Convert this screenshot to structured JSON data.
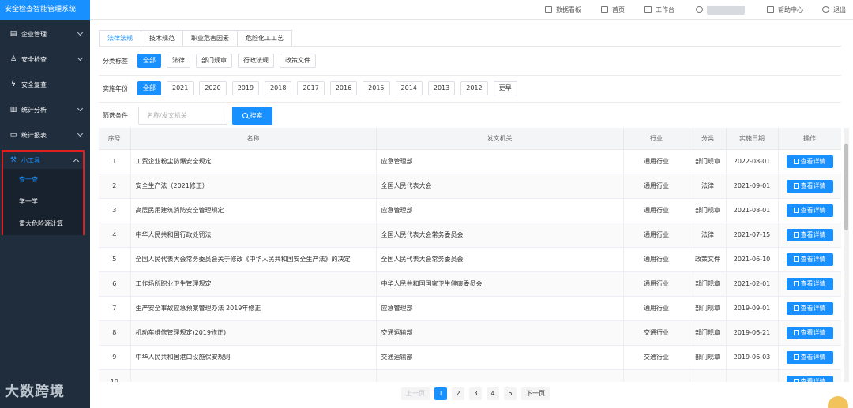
{
  "app": {
    "title": "安全检查智能管理系统"
  },
  "sidebar": {
    "items": [
      {
        "label": "企业管理",
        "icon": "building-icon"
      },
      {
        "label": "安全检查",
        "icon": "user-check-icon"
      },
      {
        "label": "安全复查",
        "icon": "lightning-icon"
      },
      {
        "label": "统计分析",
        "icon": "clipboard-icon"
      },
      {
        "label": "统计报表",
        "icon": "folder-icon"
      }
    ],
    "tools": {
      "label": "小工具",
      "icon": "tools-icon",
      "children": [
        {
          "label": "查一查"
        },
        {
          "label": "学一学"
        },
        {
          "label": "重大危险源计算"
        }
      ]
    }
  },
  "header": {
    "data_board": "数据看板",
    "home": "首页",
    "workbench": "工作台",
    "help": "帮助中心",
    "logout": "退出"
  },
  "tabs": [
    "法律法规",
    "技术规范",
    "职业危害因素",
    "危险化工工艺"
  ],
  "filters": {
    "category_label": "分类标签",
    "categories": [
      "全部",
      "法律",
      "部门规章",
      "行政法规",
      "政策文件"
    ],
    "year_label": "实施年份",
    "years": [
      "全部",
      "2021",
      "2020",
      "2019",
      "2018",
      "2017",
      "2016",
      "2015",
      "2014",
      "2013",
      "2012",
      "更早"
    ],
    "condition_label": "筛选条件",
    "search_placeholder": "名称/发文机关",
    "search_button": "搜索"
  },
  "table": {
    "columns": [
      "序号",
      "名称",
      "发文机关",
      "行业",
      "分类",
      "实施日期",
      "操作"
    ],
    "detail_label": "查看详情",
    "rows": [
      {
        "no": "1",
        "name": "工贸企业粉尘防爆安全规定",
        "issuer": "应急管理部",
        "industry": "通用行业",
        "category": "部门规章",
        "date": "2022-08-01"
      },
      {
        "no": "2",
        "name": "安全生产法（2021修正）",
        "issuer": "全国人民代表大会",
        "industry": "通用行业",
        "category": "法律",
        "date": "2021-09-01"
      },
      {
        "no": "3",
        "name": "高层民用建筑消防安全管理规定",
        "issuer": "应急管理部",
        "industry": "通用行业",
        "category": "部门规章",
        "date": "2021-08-01"
      },
      {
        "no": "4",
        "name": "中华人民共和国行政处罚法",
        "issuer": "全国人民代表大会常务委员会",
        "industry": "通用行业",
        "category": "法律",
        "date": "2021-07-15"
      },
      {
        "no": "5",
        "name": "全国人民代表大会常务委员会关于修改《中华人民共和国安全生产法》的决定",
        "issuer": "全国人民代表大会常务委员会",
        "industry": "通用行业",
        "category": "政策文件",
        "date": "2021-06-10"
      },
      {
        "no": "6",
        "name": "工作场所职业卫生管理规定",
        "issuer": "中华人民共和国国家卫生健康委员会",
        "industry": "通用行业",
        "category": "部门规章",
        "date": "2021-02-01"
      },
      {
        "no": "7",
        "name": "生产安全事故应急预案管理办法 2019年修正",
        "issuer": "应急管理部",
        "industry": "通用行业",
        "category": "部门规章",
        "date": "2019-09-01"
      },
      {
        "no": "8",
        "name": "机动车维修管理规定(2019修正)",
        "issuer": "交通运输部",
        "industry": "交通行业",
        "category": "部门规章",
        "date": "2019-06-21"
      },
      {
        "no": "9",
        "name": "中华人民共和国港口设施保安规则",
        "issuer": "交通运输部",
        "industry": "交通行业",
        "category": "部门规章",
        "date": "2019-06-03"
      },
      {
        "no": "10",
        "name": "",
        "issuer": "",
        "industry": "",
        "category": "",
        "date": ""
      }
    ]
  },
  "pagination": {
    "prev": "上一页",
    "next": "下一页",
    "pages": [
      "1",
      "2",
      "3",
      "4",
      "5"
    ],
    "current": "1"
  },
  "watermark": "大数跨境",
  "colors": {
    "primary": "#1890ff",
    "sidebar": "#1f2d3d",
    "highlight_border": "#e02020"
  }
}
